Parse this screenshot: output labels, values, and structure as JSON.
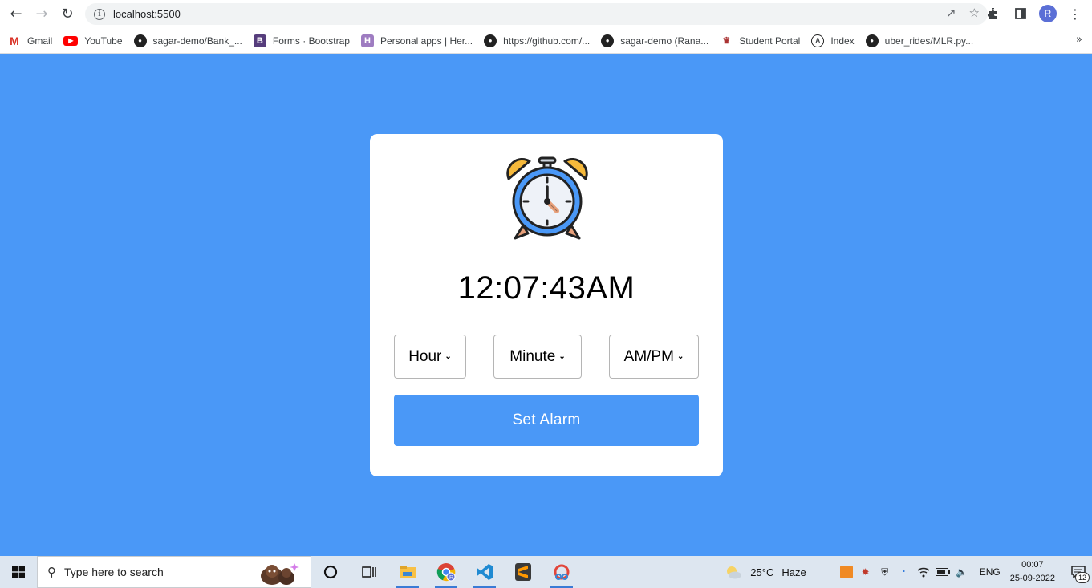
{
  "browser": {
    "url": "localhost:5500",
    "bookmarks": [
      {
        "label": "Gmail",
        "icon": "gmail-icon"
      },
      {
        "label": "YouTube",
        "icon": "youtube-icon"
      },
      {
        "label": "sagar-demo/Bank_...",
        "icon": "github-icon"
      },
      {
        "label": "Forms · Bootstrap",
        "icon": "bootstrap-icon"
      },
      {
        "label": "Personal apps | Her...",
        "icon": "heroku-icon"
      },
      {
        "label": "https://github.com/...",
        "icon": "github-icon"
      },
      {
        "label": "sagar-demo (Rana...",
        "icon": "github-icon"
      },
      {
        "label": "Student Portal",
        "icon": "portal-icon"
      },
      {
        "label": "Index",
        "icon": "index-icon"
      },
      {
        "label": "uber_rides/MLR.py...",
        "icon": "github-icon"
      }
    ],
    "profile_initial": "R"
  },
  "app": {
    "current_time": "12:07:43AM",
    "selects": {
      "hour": "Hour",
      "minute": "Minute",
      "ampm": "AM/PM"
    },
    "set_button": "Set Alarm",
    "accent_color": "#4a98f7"
  },
  "taskbar": {
    "search_placeholder": "Type here to search",
    "weather_temp": "25°C",
    "weather_desc": "Haze",
    "language": "ENG",
    "time": "00:07",
    "date": "25-09-2022",
    "notification_count": "12"
  }
}
